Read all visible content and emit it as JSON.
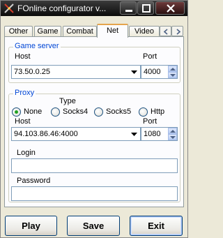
{
  "window": {
    "title": "FOnline configurator  v...",
    "icons": {
      "app": "crossed-swords-icon",
      "minimize": "minimize-icon",
      "maximize": "maximize-icon",
      "close": "close-icon"
    }
  },
  "tabs": [
    {
      "label": "Other"
    },
    {
      "label": "Game"
    },
    {
      "label": "Combat"
    },
    {
      "label": "Net",
      "active": true
    },
    {
      "label": "Video"
    }
  ],
  "game_server": {
    "group_label": "Game server",
    "host_label": "Host",
    "host_value": "73.50.0.25",
    "port_label": "Port",
    "port_value": "4000"
  },
  "proxy": {
    "group_label": "Proxy",
    "type_label": "Type",
    "types": [
      {
        "label": "None",
        "selected": true
      },
      {
        "label": "Socks4",
        "selected": false
      },
      {
        "label": "Socks5",
        "selected": false
      },
      {
        "label": "Http",
        "selected": false
      }
    ],
    "host_label": "Host",
    "host_value": "94.103.86.46:4000",
    "port_label": "Port",
    "port_value": "1080",
    "login_label": "Login",
    "login_value": "",
    "password_label": "Password",
    "password_value": ""
  },
  "buttons": {
    "play": "Play",
    "save": "Save",
    "exit": "Exit"
  },
  "colors": {
    "group_title": "#0046d5",
    "active_tab_accent": "#e5a44c",
    "radio_selected": "#21a121",
    "titlebar": "#1a1a1a"
  }
}
